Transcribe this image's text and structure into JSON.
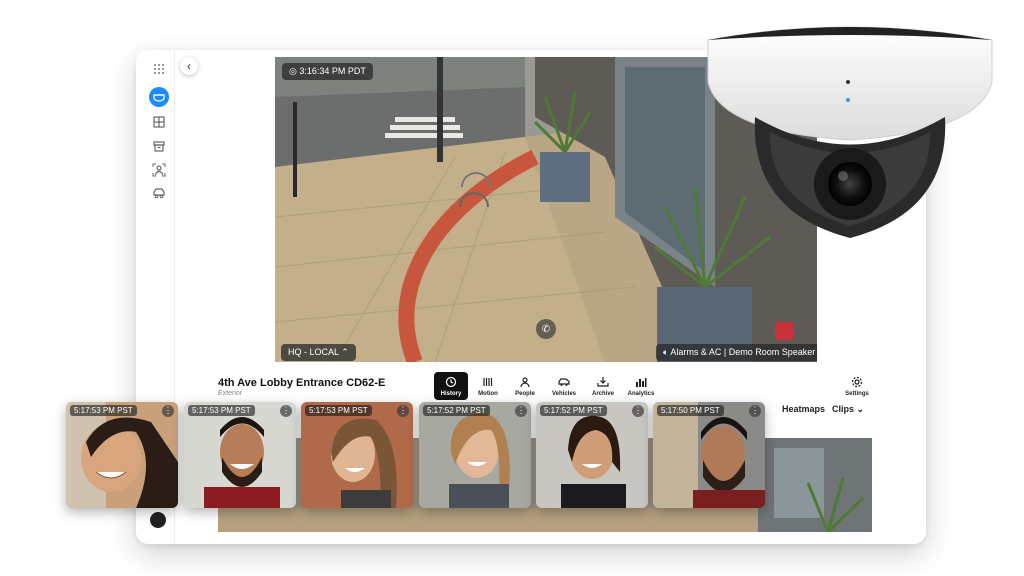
{
  "video": {
    "timestamp": "3:16:34 PM PDT",
    "site_label": "HQ - LOCAL",
    "speaker_label": "Alarms & AC | Demo Room Speaker"
  },
  "camera_info": {
    "name": "4th Ave Lobby Entrance CD62-E",
    "type": "Exterior"
  },
  "toolbar": {
    "tools": [
      "History",
      "Motion",
      "People",
      "Vehicles",
      "Archive",
      "Analytics"
    ],
    "settings": "Settings",
    "heatmaps": "Heatmaps",
    "clips": "Clips"
  },
  "thumbnails": [
    {
      "time": "5:17:53 PM PST"
    },
    {
      "time": "5:17:53 PM PST"
    },
    {
      "time": "5:17:53 PM PST"
    },
    {
      "time": "5:17:52 PM PST"
    },
    {
      "time": "5:17:52 PM PST"
    },
    {
      "time": "5:17:50 PM PST"
    }
  ],
  "colors": {
    "accent": "#1a8cff",
    "active_tool": "#111111"
  },
  "icons": {
    "sidebar": [
      "grid-icon",
      "camera-icon",
      "layout-icon",
      "archive-icon",
      "person-scan-icon",
      "vehicle-icon"
    ]
  }
}
